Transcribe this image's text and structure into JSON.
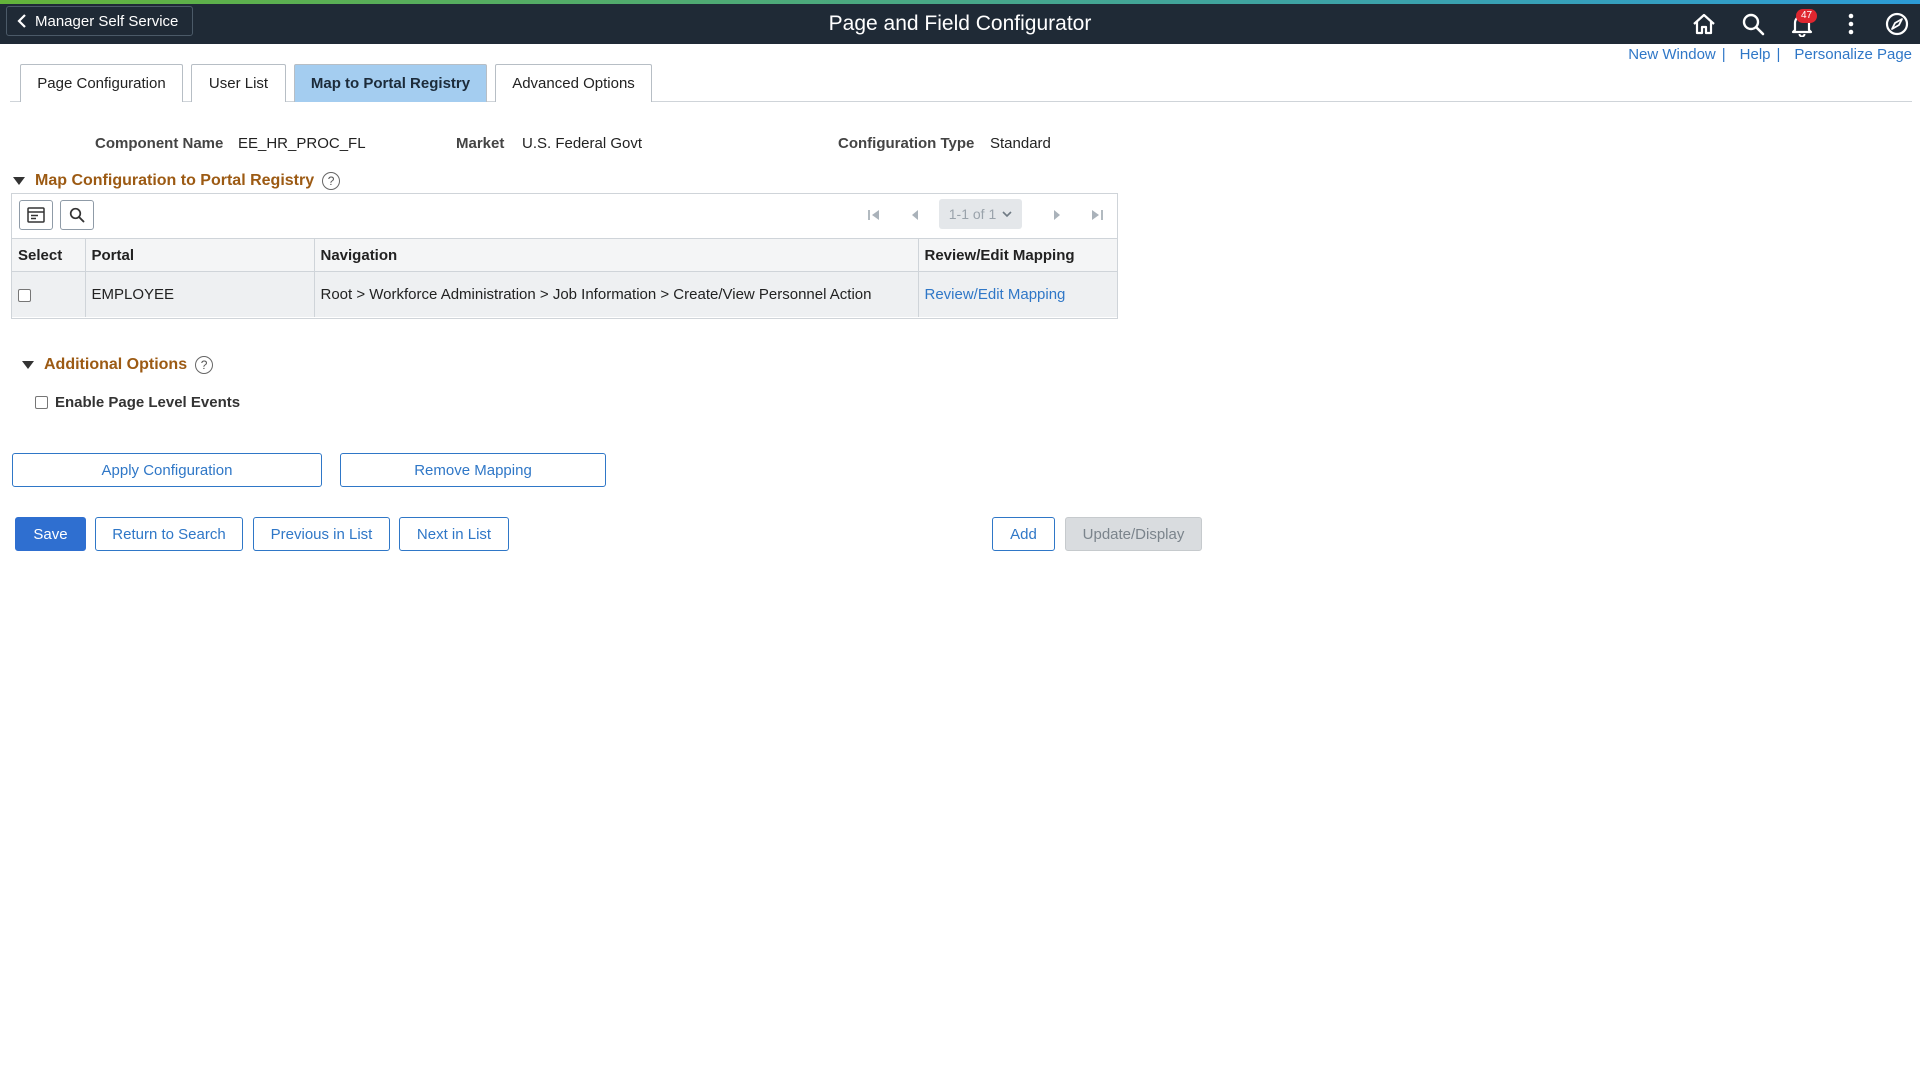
{
  "header": {
    "back_label": "Manager Self Service",
    "title": "Page and Field Configurator",
    "notification_count": "47",
    "icons": [
      "home-icon",
      "search-icon",
      "notification-bell-icon",
      "actions-menu-icon",
      "navbar-compass-icon"
    ]
  },
  "toplinks": {
    "new_window": "New Window",
    "help": "Help",
    "personalize": "Personalize Page",
    "separator": "|"
  },
  "tabs": [
    {
      "label": "Page Configuration",
      "active": false
    },
    {
      "label": "User List",
      "active": false
    },
    {
      "label": "Map to Portal Registry",
      "active": true
    },
    {
      "label": "Advanced Options",
      "active": false
    }
  ],
  "info": {
    "component_label": "Component Name",
    "component_value": "EE_HR_PROC_FL",
    "market_label": "Market",
    "market_value": "U.S. Federal Govt",
    "config_type_label": "Configuration Type",
    "config_type_value": "Standard"
  },
  "map_section": {
    "title": "Map Configuration to Portal Registry",
    "help": "?",
    "pager": "1-1 of 1",
    "columns": [
      "Select",
      "Portal",
      "Navigation",
      "Review/Edit Mapping"
    ],
    "rows": [
      {
        "selected": false,
        "portal": "EMPLOYEE",
        "navigation": "Root > Workforce Administration > Job Information > Create/View Personnel Action",
        "link": "Review/Edit Mapping"
      }
    ]
  },
  "additional": {
    "title": "Additional Options",
    "help": "?",
    "enable_events_label": "Enable Page Level Events",
    "enable_events_checked": false
  },
  "actions": {
    "apply": "Apply Configuration",
    "remove": "Remove Mapping"
  },
  "footer": {
    "save": "Save",
    "return": "Return to Search",
    "previous": "Previous in List",
    "next": "Next in List",
    "add": "Add",
    "update": "Update/Display"
  },
  "colors": {
    "header_bg": "#1f2a36",
    "accent": "#2f77c7",
    "active_tab": "#a4cdf0",
    "section_title": "#9c5a13",
    "badge": "#e0262f"
  }
}
